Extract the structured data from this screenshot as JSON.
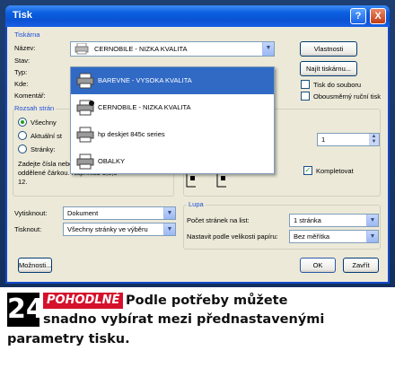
{
  "window": {
    "title": "Tisk",
    "help_glyph": "?",
    "close_glyph": "X"
  },
  "printer_group": {
    "title": "Tiskárna",
    "name_label": "Název:",
    "status_label": "Stav:",
    "type_label": "Typ:",
    "where_label": "Kde:",
    "comment_label": "Komentář:",
    "selected_printer": "CERNOBILE - NIZKA KVALITA",
    "properties_button": "Vlastnosti",
    "find_printer_button": "Najít tiskárnu...",
    "print_to_file_label": "Tisk do souboru",
    "duplex_label": "Obousměrný ruční tisk"
  },
  "printer_dropdown": {
    "items": [
      {
        "label": "BAREVNE - VYSOKA KVALITA",
        "selected": true,
        "icon": "printer-icon"
      },
      {
        "label": "CERNOBILE - NIZKA KVALITA",
        "selected": false,
        "icon": "default-printer-icon"
      },
      {
        "label": "hp deskjet 845c series",
        "selected": false,
        "icon": "printer-icon"
      },
      {
        "label": "OBALKY",
        "selected": false,
        "icon": "printer-icon"
      }
    ]
  },
  "page_range": {
    "title": "Rozsah strán",
    "all_label": "Všechny",
    "current_label": "Aktuální st",
    "pages_label": "Stránky:",
    "hint": "Zadejte čísla nebo rozsah stránek oddělené čárkou. Například 1,3,5–12."
  },
  "copies": {
    "count": "1",
    "collate_label": "Kompletovat"
  },
  "print_what": {
    "label": "Vytisknout:",
    "value": "Dokument"
  },
  "print": {
    "label": "Tisknout:",
    "value": "Všechny stránky ve výběru"
  },
  "zoom": {
    "title": "Lupa",
    "pages_per_sheet_label": "Počet stránek na list:",
    "pages_per_sheet_value": "1 stránka",
    "scale_label": "Nastavit podle velikosti papíru:",
    "scale_value": "Bez měřítka"
  },
  "footer": {
    "options_button": "Možnosti...",
    "ok_button": "OK",
    "close_button": "Zavřít"
  },
  "caption": {
    "number": "24",
    "tag": "POHODLNÉ",
    "line1": "Podle potřeby můžete",
    "line2": "snadno vybírat mezi přednastavenými",
    "line3": "parametry tisku."
  },
  "colors": {
    "titlebar": "#0a52d4",
    "selection": "#316ac5",
    "tag": "#d5112b",
    "dialog_bg": "#ece9d8",
    "group_title": "#1d4ed8"
  }
}
